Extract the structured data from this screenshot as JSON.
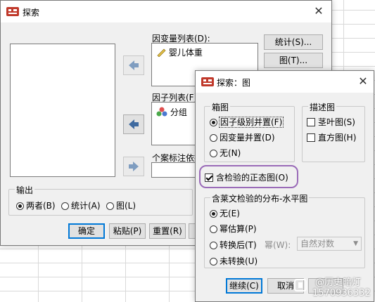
{
  "main_dialog": {
    "title": "探索",
    "dependent_list_label": "因变量列表(D):",
    "dependent_items": [
      "婴儿体重"
    ],
    "factor_list_label": "因子列表(F):",
    "factor_items": [
      "分组"
    ],
    "case_label_label": "个案标注依据",
    "buttons_right": [
      "统计(S)...",
      "图(T)..."
    ],
    "output_group_title": "输出",
    "output_options": [
      {
        "label": "两者(B)",
        "selected": true
      },
      {
        "label": "统计(A)",
        "selected": false
      },
      {
        "label": "图(L)",
        "selected": false
      }
    ],
    "bottom_buttons": [
      "确定",
      "粘贴(P)",
      "重置(R)"
    ]
  },
  "plots_dialog": {
    "title": "探索：图",
    "boxplot_group_title": "箱图",
    "boxplot_options": [
      {
        "label": "因子级别并置(F)",
        "selected": true
      },
      {
        "label": "因变量并置(D)",
        "selected": false
      },
      {
        "label": "无(N)",
        "selected": false
      }
    ],
    "descriptive_group_title": "描述图",
    "descriptive_options": [
      {
        "label": "茎叶图(S)",
        "checked": false
      },
      {
        "label": "直方图(H)",
        "checked": false
      }
    ],
    "normality_check": {
      "label": "含检验的正态图(O)",
      "checked": true
    },
    "levene_group_title": "含莱文检验的分布-水平图",
    "levene_options": [
      {
        "label": "无(E)",
        "selected": true
      },
      {
        "label": "幂估算(P)",
        "selected": false
      },
      {
        "label": "转换后(T)",
        "selected": false
      },
      {
        "label": "未转换(U)",
        "selected": false
      }
    ],
    "power_label": "幂(W):",
    "power_value": "自然对数",
    "buttons": [
      "继续(C)",
      "取消"
    ]
  },
  "watermark": [
    "@历史暗灯",
    "1570936332"
  ],
  "colors": {
    "accent": "#0078d7",
    "highlight": "#9a6bb8",
    "arrow": "#5a7fa8"
  }
}
